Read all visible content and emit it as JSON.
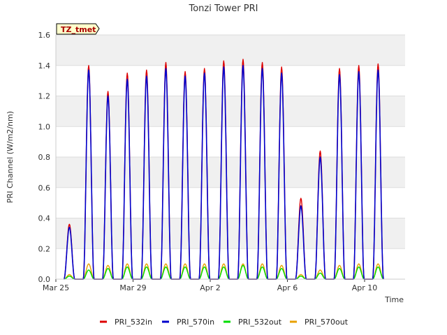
{
  "chart_data": {
    "type": "line",
    "title": "Tonzi Tower PRI",
    "xlabel": "Time",
    "ylabel": "PRI Channel (W/m2/nm)",
    "badge": "TZ_tmet",
    "ylim": [
      0.0,
      1.6
    ],
    "yticks": [
      "0.0",
      "0.2",
      "0.4",
      "0.6",
      "0.8",
      "1.0",
      "1.2",
      "1.4",
      "1.6"
    ],
    "xlim_days": [
      0,
      18.1
    ],
    "xticks": [
      {
        "label": "Mar 25",
        "day": 0
      },
      {
        "label": "Mar 29",
        "day": 4
      },
      {
        "label": "Apr 2",
        "day": 8
      },
      {
        "label": "Apr 6",
        "day": 12
      },
      {
        "label": "Apr 10",
        "day": 16
      }
    ],
    "grid": true,
    "legend_position": "bottom",
    "days_x": [
      0.7,
      1.7,
      2.7,
      3.7,
      4.7,
      5.7,
      6.7,
      7.7,
      8.7,
      9.7,
      10.7,
      11.7,
      12.7,
      13.7,
      14.7,
      15.7,
      16.7
    ],
    "series": [
      {
        "name": "PRI_532in",
        "color": "#dd0000",
        "values": [
          0.36,
          1.4,
          1.23,
          1.35,
          1.37,
          1.42,
          1.36,
          1.38,
          1.43,
          1.44,
          1.42,
          1.39,
          0.53,
          0.84,
          1.38,
          1.4,
          1.41
        ]
      },
      {
        "name": "PRI_570in",
        "color": "#0000cc",
        "values": [
          0.34,
          1.37,
          1.2,
          1.31,
          1.33,
          1.38,
          1.33,
          1.35,
          1.39,
          1.4,
          1.38,
          1.35,
          0.48,
          0.8,
          1.34,
          1.36,
          1.37
        ]
      },
      {
        "name": "PRI_532out",
        "color": "#00dd00",
        "values": [
          0.02,
          0.06,
          0.07,
          0.08,
          0.08,
          0.08,
          0.08,
          0.08,
          0.08,
          0.09,
          0.08,
          0.07,
          0.02,
          0.04,
          0.07,
          0.08,
          0.08
        ]
      },
      {
        "name": "PRI_570out",
        "color": "#e8a000",
        "values": [
          0.03,
          0.1,
          0.09,
          0.1,
          0.1,
          0.1,
          0.1,
          0.1,
          0.1,
          0.1,
          0.1,
          0.09,
          0.03,
          0.06,
          0.09,
          0.1,
          0.1
        ]
      }
    ]
  }
}
